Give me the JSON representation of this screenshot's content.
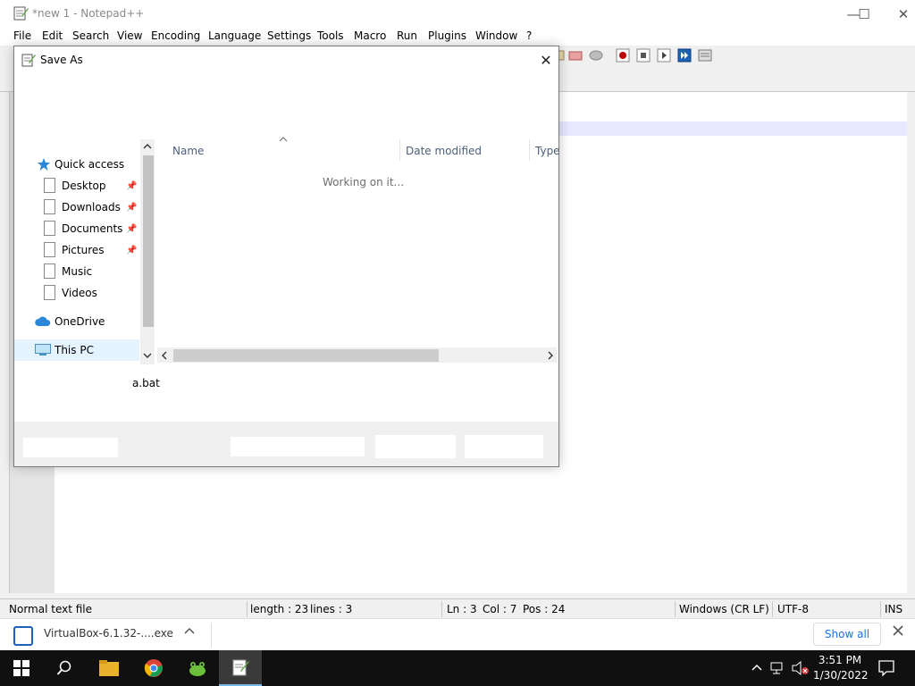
{
  "window": {
    "title": "*new 1 - Notepad++",
    "controls": {
      "minimize": "—",
      "maximize": "☐",
      "close": "✕"
    }
  },
  "menu": [
    "File",
    "Edit",
    "Search",
    "View",
    "Encoding",
    "Language",
    "Settings",
    "Tools",
    "Macro",
    "Run",
    "Plugins",
    "Window",
    "?"
  ],
  "status": {
    "filetype": "Normal text file",
    "length": "length : 23",
    "lines": "lines : 3",
    "ln": "Ln : 3",
    "col": "Col : 7",
    "pos": "Pos : 24",
    "eol": "Windows (CR LF)",
    "encoding": "UTF-8",
    "mode": "INS"
  },
  "dialog": {
    "title": "Save As",
    "close": "✕",
    "nav": {
      "quick_access": "Quick access",
      "desktop": "Desktop",
      "downloads": "Downloads",
      "documents": "Documents",
      "pictures": "Pictures",
      "music": "Music",
      "videos": "Videos",
      "onedrive": "OneDrive",
      "this_pc": "This PC"
    },
    "columns": {
      "name": "Name",
      "date_modified": "Date modified",
      "type": "Type"
    },
    "loading_text": "Working on it...",
    "filename_fragment": "a.bat"
  },
  "download_bar": {
    "item": "VirtualBox-6.1.32-....exe",
    "show_all": "Show all"
  },
  "taskbar": {
    "time": "3:51 PM",
    "date": "1/30/2022"
  },
  "colors": {
    "accent": "#1a73e8",
    "selection": "#e5f3ff",
    "taskbar": "#101010"
  }
}
